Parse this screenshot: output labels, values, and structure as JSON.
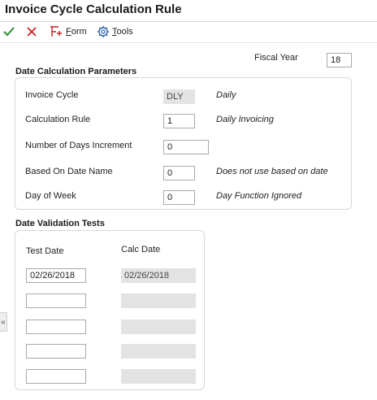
{
  "page": {
    "title": "Invoice Cycle Calculation Rule"
  },
  "toolbar": {
    "ok_icon": "checkmark-icon",
    "cancel_icon": "close-icon",
    "form_label": "Form",
    "form_accesskey": "F",
    "form_rest": "orm",
    "tools_label": "Tools",
    "tools_accesskey": "T",
    "tools_rest": "ools"
  },
  "fiscal_year": {
    "label": "Fiscal Year",
    "value": "18"
  },
  "date_params": {
    "title": "Date Calculation Parameters",
    "invoice_cycle": {
      "label": "Invoice Cycle",
      "value": "DLY",
      "description": "Daily"
    },
    "calculation_rule": {
      "label": "Calculation Rule",
      "value": "1",
      "description": "Daily Invoicing"
    },
    "days_increment": {
      "label": "Number of Days Increment",
      "value": "0"
    },
    "based_on_date": {
      "label": "Based On Date Name",
      "value": "0",
      "description": "Does not use based on date"
    },
    "day_of_week": {
      "label": "Day of Week",
      "value": "0",
      "description": "Day Function Ignored"
    }
  },
  "validation": {
    "title": "Date Validation Tests",
    "test_date_header": "Test Date",
    "calc_date_header": "Calc Date",
    "rows": [
      {
        "test": "02/26/2018",
        "calc": "02/26/2018"
      },
      {
        "test": "",
        "calc": ""
      },
      {
        "test": "",
        "calc": ""
      },
      {
        "test": "",
        "calc": ""
      },
      {
        "test": "",
        "calc": ""
      }
    ]
  },
  "side_tab": {
    "glyph": "«"
  },
  "colors": {
    "ok": "#2e8b2e",
    "cancel": "#cc2222",
    "form_icon": "#cc2222",
    "tools_icon": "#3366aa"
  }
}
